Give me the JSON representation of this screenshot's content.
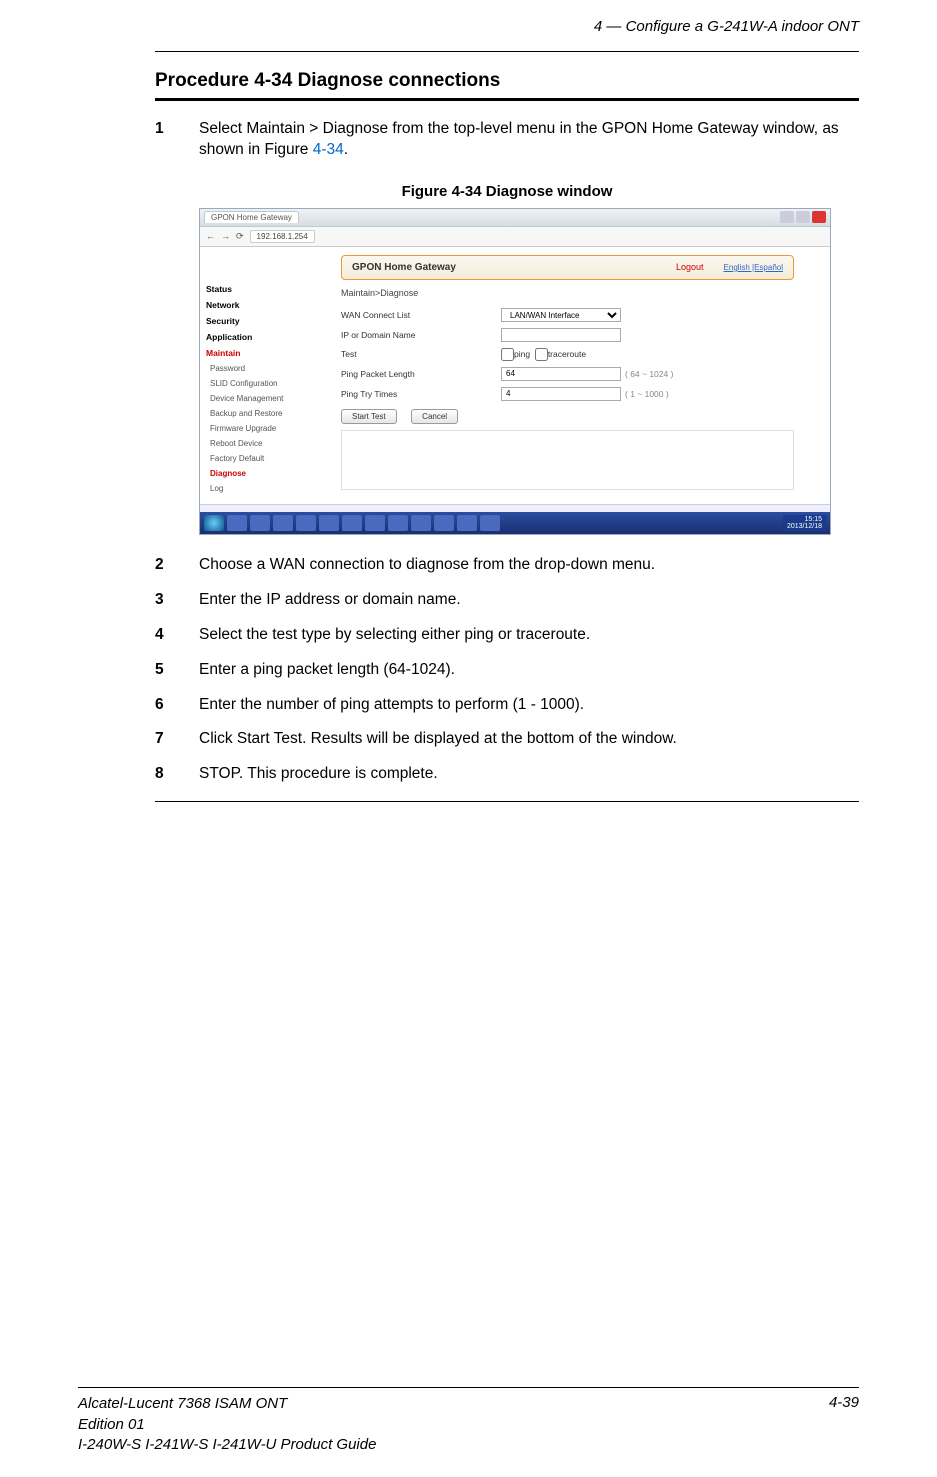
{
  "header": {
    "right": "4 —  Configure a G-241W-A indoor ONT"
  },
  "procedure_title": "Procedure 4-34  Diagnose connections",
  "steps": [
    {
      "n": "1",
      "text_a": "Select Maintain > Diagnose from the top-level menu in the GPON Home Gateway window, as shown in Figure ",
      "figref": "4-34",
      "text_b": "."
    },
    {
      "n": "2",
      "text": "Choose a WAN connection to diagnose from the drop-down menu."
    },
    {
      "n": "3",
      "text": "Enter the IP address or domain name."
    },
    {
      "n": "4",
      "text": "Select the test type by selecting either ping or traceroute."
    },
    {
      "n": "5",
      "text": "Enter a ping packet length (64-1024)."
    },
    {
      "n": "6",
      "text": "Enter the number of ping attempts to perform (1 - 1000)."
    },
    {
      "n": "7",
      "text": "Click Start Test. Results will be displayed at the bottom of the window."
    },
    {
      "n": "8",
      "text": "STOP. This procedure is complete."
    }
  ],
  "figure_caption": "Figure 4-34  Diagnose window",
  "screenshot": {
    "tab": "GPON Home Gateway",
    "url": "192.168.1.254",
    "topbar": {
      "title": "GPON Home Gateway",
      "logout": "Logout",
      "lang": "English |Español"
    },
    "crumb": "Maintain>Diagnose",
    "sidebar": {
      "top": [
        "Status",
        "Network",
        "Security",
        "Application",
        "Maintain"
      ],
      "sub": [
        "Password",
        "SLID Configuration",
        "Device Management",
        "Backup and Restore",
        "Firmware Upgrade",
        "Reboot Device",
        "Factory Default",
        "Diagnose",
        "Log"
      ],
      "active": "Diagnose",
      "active_top": "Maintain"
    },
    "form": {
      "wan_label": "WAN Connect List",
      "wan_value": "LAN/WAN Interface",
      "ip_label": "IP or Domain Name",
      "test_label": "Test",
      "ping": "ping",
      "trace": "traceroute",
      "ppl_label": "Ping Packet Length",
      "ppl_value": "64",
      "ppl_note": "( 64 ~ 1024 )",
      "ptt_label": "Ping Try Times",
      "ptt_value": "4",
      "ptt_note": "( 1 ~ 1000 )",
      "start": "Start Test",
      "cancel": "Cancel"
    },
    "clock": {
      "time": "15:15",
      "date": "2013/12/18"
    }
  },
  "footer": {
    "line1": "Alcatel-Lucent 7368 ISAM ONT",
    "line2": "Edition 01",
    "line3": "I-240W-S I-241W-S I-241W-U Product Guide",
    "page": "4-39"
  }
}
